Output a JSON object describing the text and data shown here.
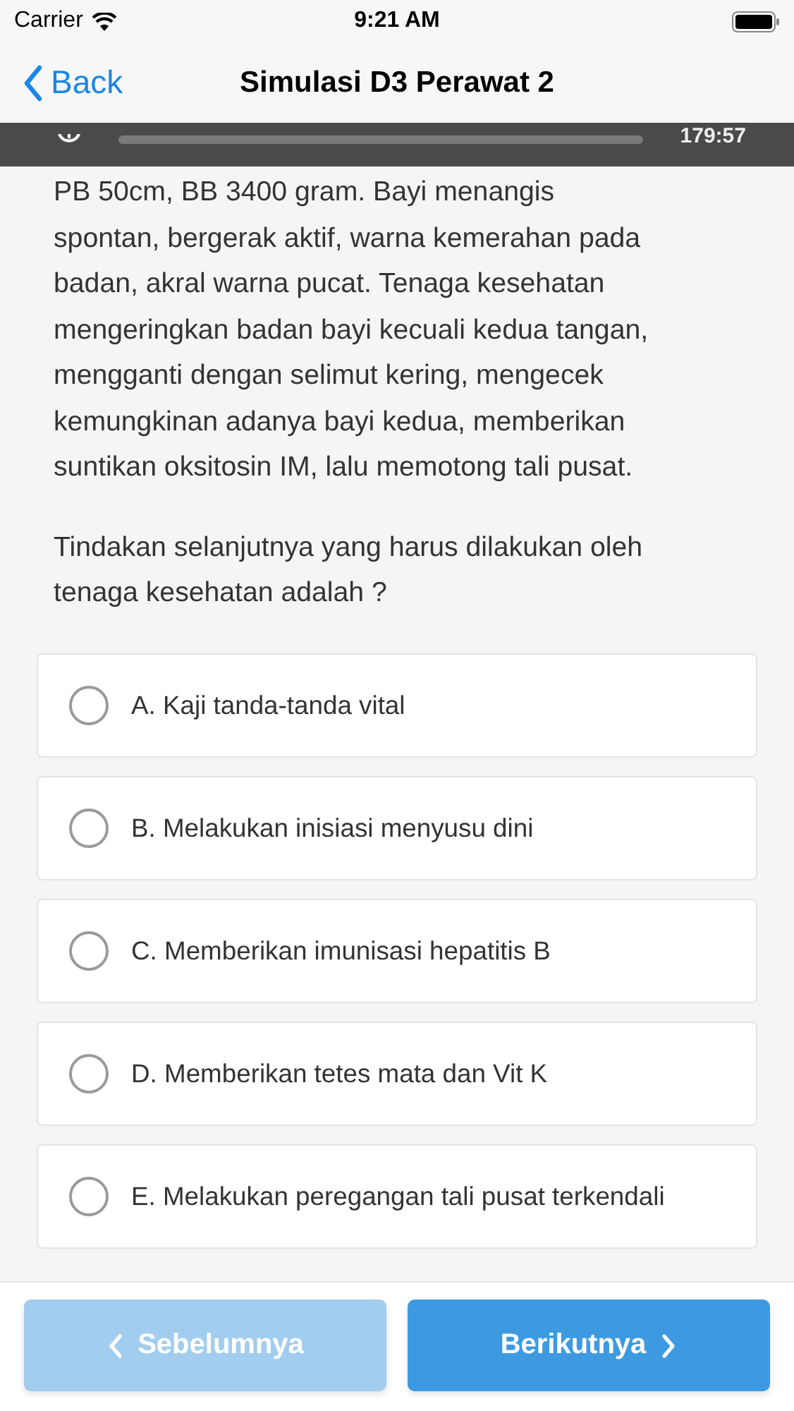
{
  "status_bar": {
    "carrier": "Carrier",
    "time": "9:21 AM"
  },
  "nav_bar": {
    "back": "Back",
    "title": "Simulasi D3 Perawat 2"
  },
  "timer": {
    "time": "179:57"
  },
  "passage": "PB 50cm, BB 3400 gram. Bayi menangis\nspontan, bergerak aktif, warna kemerahan pada\nbadan, akral warna pucat. Tenaga kesehatan\nmengeringkan badan bayi kecuali kedua tangan,\nmengganti dengan selimut kering, mengecek\nkemungkinan adanya bayi kedua, memberikan\nsuntikan oksitosin IM, lalu memotong tali pusat.",
  "question": "Tindakan selanjutnya yang harus dilakukan oleh\ntenaga kesehatan adalah ?",
  "options": [
    {
      "label": "A. Kaji tanda-tanda vital",
      "selected": false
    },
    {
      "label": "B. Melakukan inisiasi menyusu dini",
      "selected": false
    },
    {
      "label": "C. Memberikan imunisasi hepatitis B",
      "selected": false
    },
    {
      "label": "D. Memberikan tetes mata dan Vit K",
      "selected": false
    },
    {
      "label": "E. Melakukan peregangan tali pusat terkendali",
      "selected": false
    }
  ],
  "buttons": [
    {
      "label": "Sebelumnya",
      "kind": "prev",
      "disabled": true
    },
    {
      "label": "Berikutnya",
      "kind": "next",
      "disabled": false
    }
  ]
}
